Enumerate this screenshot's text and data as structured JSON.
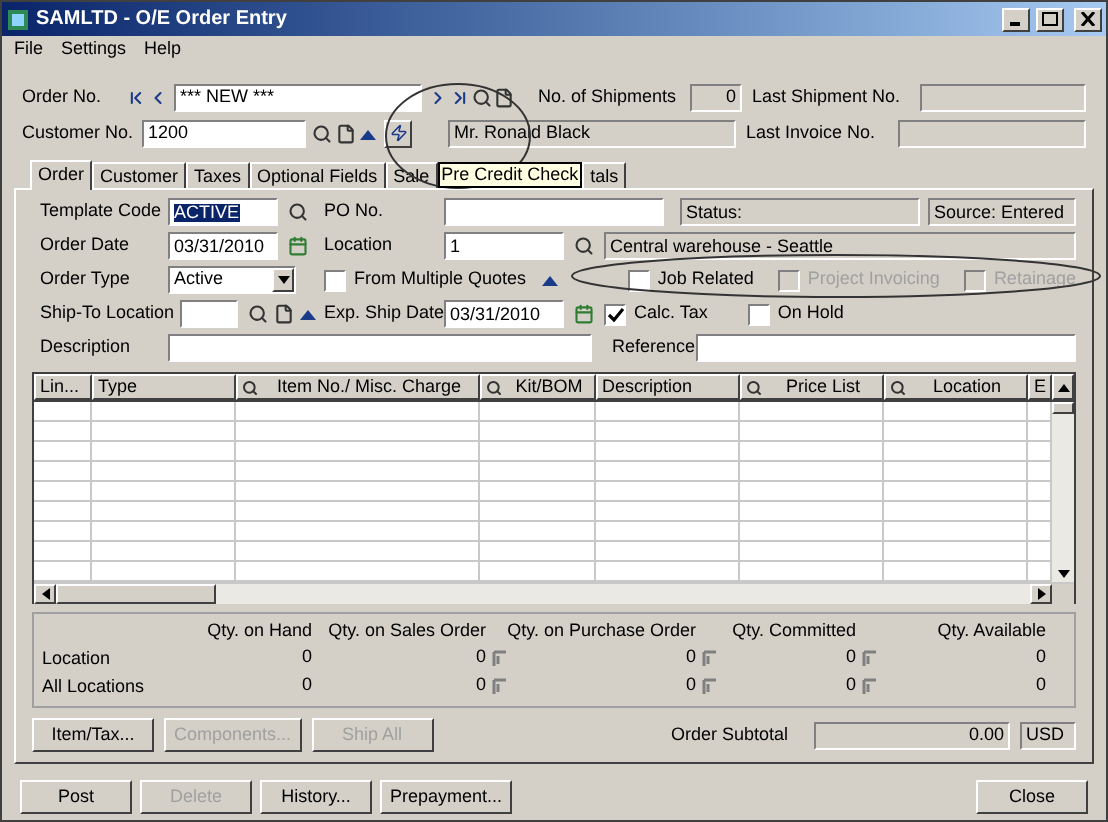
{
  "window": {
    "title": "SAMLTD - O/E Order Entry"
  },
  "menu": [
    {
      "label": "File"
    },
    {
      "label": "Settings"
    },
    {
      "label": "Help"
    }
  ],
  "header": {
    "order_no": {
      "label": "Order No.",
      "value": "*** NEW ***"
    },
    "shipments": {
      "label": "No. of Shipments",
      "value": "0"
    },
    "last_shipment": {
      "label": "Last Shipment No."
    },
    "customer_no": {
      "label": "Customer No.",
      "value": "1200"
    },
    "customer_name": {
      "value": "Mr. Ronald Black"
    },
    "last_invoice": {
      "label": "Last Invoice No."
    }
  },
  "tabs": [
    {
      "label": "Order",
      "selected": true
    },
    {
      "label": "Customer",
      "selected": false
    },
    {
      "label": "Taxes",
      "selected": false
    },
    {
      "label": "Optional Fields",
      "selected": false
    },
    {
      "label": "Sale",
      "selected": false
    }
  ],
  "tooltip": {
    "text": "Pre Credit Check"
  },
  "tabs_after_tooltip": [
    {
      "label": "tals",
      "selected": false
    }
  ],
  "order": {
    "template_code": {
      "label": "Template Code",
      "value": "ACTIVE"
    },
    "po_no": {
      "label": "PO No."
    },
    "status": {
      "value": "Status:"
    },
    "source": {
      "value": "Source: Entered"
    },
    "order_date": {
      "label": "Order Date",
      "value": "03/31/2010"
    },
    "location": {
      "label": "Location",
      "value": "1",
      "description": "Central warehouse - Seattle"
    },
    "order_type": {
      "label": "Order Type",
      "value": "Active"
    },
    "ship_to": {
      "label": "Ship-To Location"
    },
    "exp_ship_date": {
      "label": "Exp. Ship Date",
      "value": "03/31/2010"
    },
    "description": {
      "label": "Description"
    },
    "reference": {
      "label": "Reference"
    }
  },
  "checkboxes_row1": [
    {
      "label": "From Multiple Quotes",
      "checked": false,
      "disabled": false
    }
  ],
  "checkboxes_row2": [
    {
      "label": "Job Related",
      "checked": false,
      "disabled": false
    },
    {
      "label": "Project Invoicing",
      "checked": false,
      "disabled": true
    },
    {
      "label": "Retainage",
      "checked": false,
      "disabled": true
    }
  ],
  "checkboxes_row3": [
    {
      "label": "Calc. Tax",
      "checked": true,
      "disabled": false
    },
    {
      "label": "On Hold",
      "checked": false,
      "disabled": false
    }
  ],
  "grid": {
    "columns": [
      {
        "label": "Lin...",
        "searchable": false
      },
      {
        "label": "Type",
        "searchable": false
      },
      {
        "label": "Item No./ Misc. Charge",
        "searchable": true
      },
      {
        "label": "Kit/BOM",
        "searchable": true
      },
      {
        "label": "Description",
        "searchable": false
      },
      {
        "label": "Price List",
        "searchable": true
      },
      {
        "label": "Location",
        "searchable": true
      },
      {
        "label": "E",
        "searchable": false
      }
    ]
  },
  "quantities": {
    "columns": [
      {
        "label": "Qty. on Hand",
        "drilldown": false
      },
      {
        "label": "Qty. on Sales Order",
        "drilldown": true
      },
      {
        "label": "Qty. on Purchase Order",
        "drilldown": true
      },
      {
        "label": "Qty. Committed",
        "drilldown": true
      },
      {
        "label": "Qty. Available",
        "drilldown": false
      }
    ],
    "rows": [
      {
        "label": "Location",
        "values": [
          "0",
          "0",
          "0",
          "0",
          "0"
        ]
      },
      {
        "label": "All Locations",
        "values": [
          "0",
          "0",
          "0",
          "0",
          "0"
        ]
      }
    ]
  },
  "panel_buttons": [
    {
      "label": "Item/Tax...",
      "disabled": false
    },
    {
      "label": "Components...",
      "disabled": true
    },
    {
      "label": "Ship All",
      "disabled": true
    }
  ],
  "subtotal": {
    "label": "Order Subtotal",
    "value": "0.00",
    "currency": "USD"
  },
  "footer_buttons": [
    {
      "label": "Post",
      "disabled": false
    },
    {
      "label": "Delete",
      "disabled": true
    },
    {
      "label": "History...",
      "disabled": false
    },
    {
      "label": "Prepayment...",
      "disabled": false
    }
  ],
  "close_button": {
    "label": "Close",
    "disabled": false
  }
}
